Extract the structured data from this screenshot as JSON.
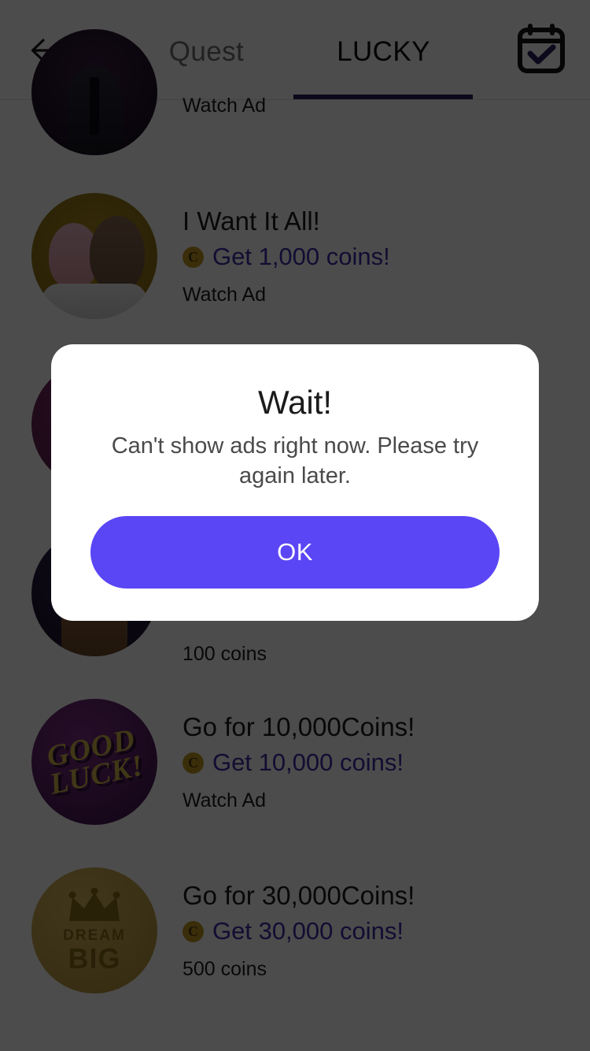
{
  "header": {
    "back_icon": "arrow-left-icon",
    "calendar_icon": "calendar-check-icon",
    "tabs": [
      {
        "label": "Quest",
        "active": false
      },
      {
        "label": "LUCKY",
        "active": true
      }
    ],
    "active_underline_color": "#2b2060"
  },
  "list": {
    "items": [
      {
        "avatar": "avatar-suit-character",
        "title": "",
        "reward": "",
        "action": "Watch Ad",
        "clipped_top": true
      },
      {
        "avatar": "avatar-two-girls",
        "title": "I Want It All!",
        "coin_icon": "coin-icon",
        "reward": "Get 1,000 coins!",
        "action": "Watch Ad"
      },
      {
        "avatar": "avatar-magenta-character",
        "title": "",
        "reward": "",
        "action": "",
        "hidden_behind_dialog": true
      },
      {
        "avatar": "avatar-night-character",
        "title": "",
        "reward": "",
        "action": "100 coins",
        "hidden_behind_dialog": true
      },
      {
        "avatar": "avatar-good-luck",
        "avatar_text_line1": "GOOD",
        "avatar_text_line2": "LUCK!",
        "title": "Go for 10,000Coins!",
        "coin_icon": "coin-icon",
        "reward": "Get 10,000 coins!",
        "action": "Watch Ad"
      },
      {
        "avatar": "avatar-dream-big",
        "avatar_text_line1": "DREAM",
        "avatar_text_line2": "BIG",
        "title": "Go for 30,000Coins!",
        "coin_icon": "coin-icon",
        "reward": "Get 30,000 coins!",
        "action": "500 coins"
      }
    ]
  },
  "dialog": {
    "title": "Wait!",
    "message": "Can't show ads right now. Please try again later.",
    "ok_label": "OK",
    "ok_color": "#5a46f5"
  },
  "colors": {
    "scrim": "rgba(0,0,0,0.70)",
    "reward_text": "#3b2ea8",
    "coin_badge": "#c39a23",
    "accent": "#5a46f5"
  },
  "glyphs": {
    "coin_letter": "C"
  }
}
